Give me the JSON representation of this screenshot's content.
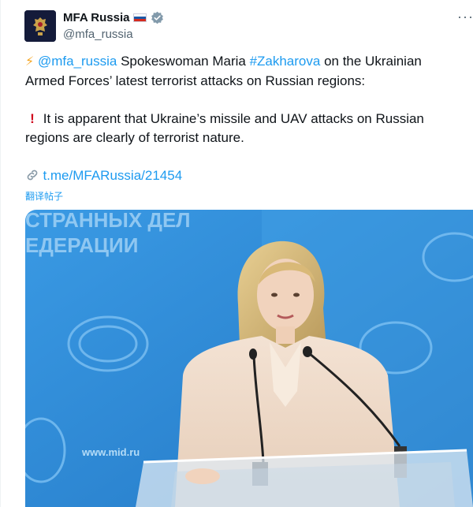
{
  "tweet": {
    "author": {
      "display_name": "MFA Russia",
      "handle": "@mfa_russia",
      "flag_colors": [
        "#ffffff",
        "#1c57a5",
        "#d52b1e"
      ],
      "verified_color": "#829aab"
    },
    "more_label": "···",
    "body": {
      "p1_mention": "@mfa_russia",
      "p1_text_a": " Spokeswoman Maria ",
      "p1_hashtag": "#Zakharova",
      "p1_text_b": " on the Ukrainian Armed Forces’ latest terrorist attacks on Russian regions:",
      "p2_text": " It is apparent that Ukraine’s missile and UAV attacks on Russian regions are clearly of terrorist nature.",
      "link_text": "t.me/MFARussia/21454"
    },
    "translate_label": "翻译帖子",
    "photo": {
      "backdrop_text_line1": "СТРАННЫХ ДЕЛ",
      "backdrop_text_line2": "ЕДЕРАЦИИ",
      "website_text": "www.mid.ru",
      "backdrop_color": "#2f8fd8"
    },
    "icons": [
      "lightning-icon",
      "exclamation-icon",
      "link-icon",
      "verified-icon",
      "more-icon"
    ],
    "link_color": "#1d9bf0"
  }
}
